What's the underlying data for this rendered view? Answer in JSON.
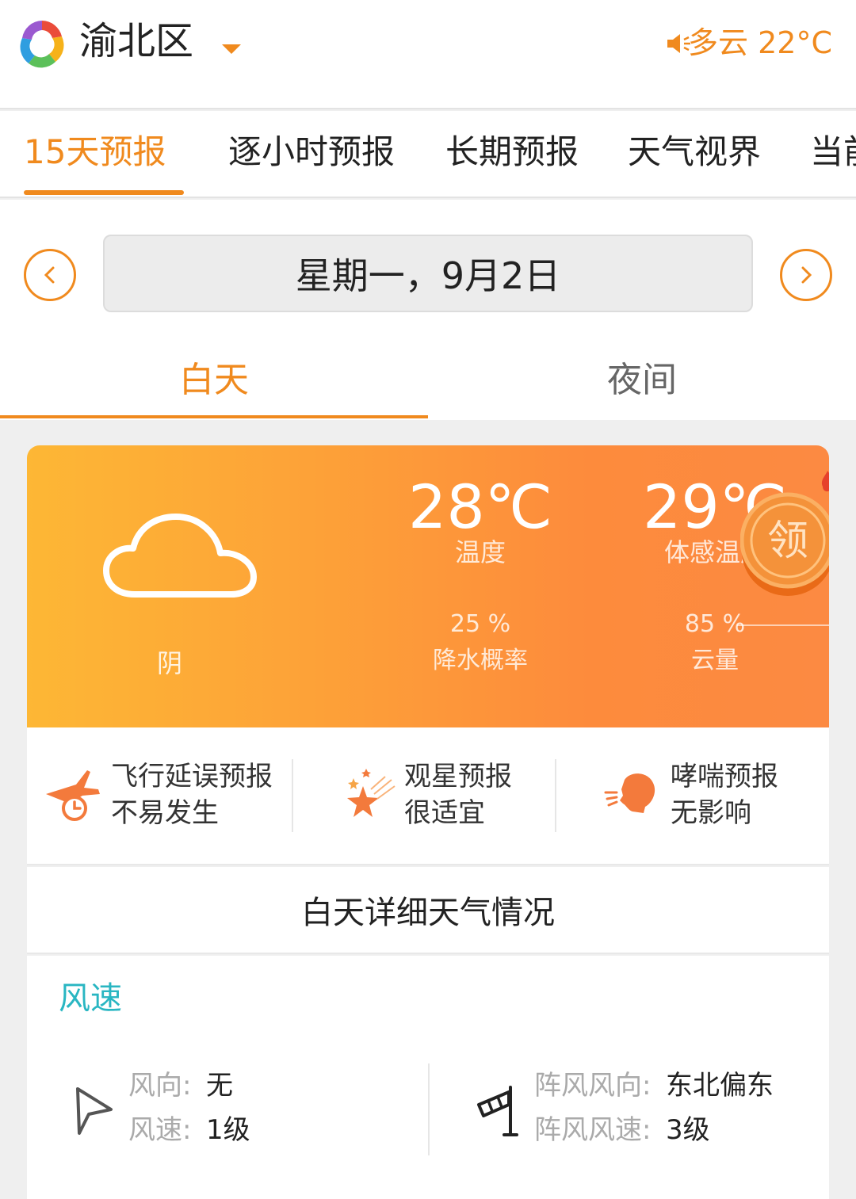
{
  "header": {
    "city": "渝北区",
    "current_weather": "多云 22°C"
  },
  "tabs": [
    {
      "label": "15天预报",
      "active": true
    },
    {
      "label": "逐小时预报",
      "active": false
    },
    {
      "label": "长期预报",
      "active": false
    },
    {
      "label": "天气视界",
      "active": false
    },
    {
      "label": "当前",
      "active": false
    }
  ],
  "date_selector": {
    "date": "星期一，9月2日"
  },
  "day_night": {
    "day": "白天",
    "night": "夜间"
  },
  "weather_card": {
    "condition": "阴",
    "temperature": "28℃",
    "temperature_label": "温度",
    "feels_like": "29℃",
    "feels_like_label": "体感温度",
    "precip": "25 %",
    "precip_label": "降水概率",
    "cloud": "85 %",
    "cloud_label": "云量",
    "coupon_text": "领",
    "colors": {
      "gradient_start": "#fdb735",
      "gradient_end": "#fc8a42"
    }
  },
  "forecasts": [
    {
      "title": "飞行延误预报",
      "value": "不易发生",
      "icon": "airplane-delay-icon"
    },
    {
      "title": "观星预报",
      "value": "很适宜",
      "icon": "stargazing-icon"
    },
    {
      "title": "哮喘预报",
      "value": "无影响",
      "icon": "asthma-icon"
    }
  ],
  "detail_title": "白天详细天气情况",
  "wind": {
    "title": "风速",
    "direction_label": "风向:",
    "direction_value": "无",
    "speed_label": "风速:",
    "speed_value": "1级",
    "gust_direction_label": "阵风风向:",
    "gust_direction_value": "东北偏东",
    "gust_speed_label": "阵风风速:",
    "gust_speed_value": "3级"
  },
  "accent_color": "#f08a1e",
  "wind_title_color": "#29b6c2"
}
